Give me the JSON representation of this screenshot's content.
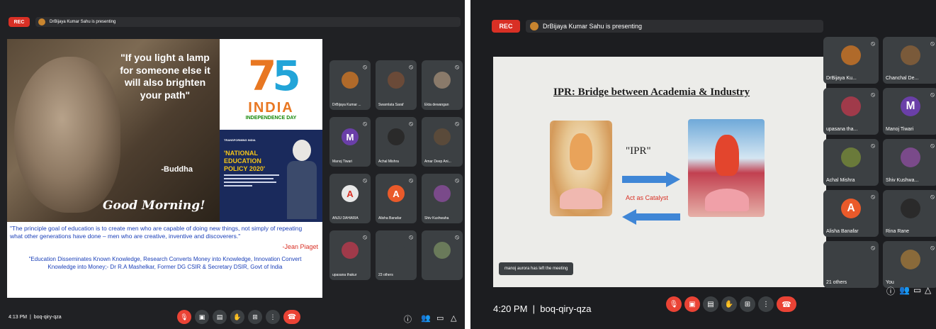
{
  "left": {
    "rec_label": "REC",
    "presenting": "DrBijaya Kumar Sahu is presenting",
    "slide": {
      "quote": "\"If you light a lamp for someone else it will also brighten your path\"",
      "quote_author": "-Buddha",
      "greeting": "Good Morning!",
      "india_logo_number": "75",
      "india_word": "INDIA",
      "india_sub": "INDEPENDENCE DAY",
      "nep_small": "TRANSFORMING INDIA",
      "nep_title": "'NATIONAL EDUCATION POLICY 2020'",
      "piaget_quote": "\"The principle goal of education is to create men who are capable of doing new things, not simply of repeating what other generations have done – men who are creative, inventive and discoverers.\"",
      "piaget_author": "-Jean Piaget",
      "mashelkar_quote": "\"Education Disseminates Known Knowledge, Research Converts Money into Knowledge, Innovation Convert Knowledge into Money;- Dr R.A Mashelkar, Former DG CSIR & Secretary DSIR, Govt of India"
    },
    "participants": [
      {
        "name": "DrBijaya Kumar ...",
        "initial": "",
        "color": "#b06a2a"
      },
      {
        "name": "Swarnlata Saraf",
        "initial": "",
        "color": "#6a4a38"
      },
      {
        "name": "Ekta dewangan",
        "initial": "",
        "color": "#8a7a6a"
      },
      {
        "name": "Manoj Tiwari",
        "initial": "M",
        "color": "#6a3fa8"
      },
      {
        "name": "Achal Mishra",
        "initial": "",
        "color": "#2a2a2a"
      },
      {
        "name": "Amar Deep Ani...",
        "initial": "",
        "color": "#5a4a3a"
      },
      {
        "name": "ANJU DAHARIA",
        "initial": "A",
        "color": "#e8e8e8"
      },
      {
        "name": "Alisha Banafar",
        "initial": "A",
        "color": "#ea5a2a"
      },
      {
        "name": "Shiv Kushwaha",
        "initial": "",
        "color": "#7a4a8a"
      },
      {
        "name": "upasana thakur",
        "initial": "",
        "color": "#a03a4a"
      },
      {
        "name": "23 others",
        "initial": "",
        "color": "#3c4043"
      },
      {
        "name": "",
        "initial": "",
        "color": "#6a7a5a"
      }
    ],
    "time": "4:13 PM",
    "meeting_code": "boq-qiry-qza"
  },
  "right": {
    "rec_label": "REC",
    "presenting": "DrBijaya Kumar Sahu is presenting",
    "slide": {
      "title": "IPR: Bridge between Academia & Industry",
      "ipr_label": "\"IPR\"",
      "catalyst": "Act as Catalyst"
    },
    "toast": "manoj aurora has left the meeting",
    "participants": [
      {
        "name": "DrBijaya Ku...",
        "initial": "",
        "color": "#b06a2a"
      },
      {
        "name": "Chanchal De...",
        "initial": "",
        "color": "#7a5a3a"
      },
      {
        "name": "upasana tha...",
        "initial": "",
        "color": "#a03a4a"
      },
      {
        "name": "Manoj Tiwari",
        "initial": "M",
        "color": "#6a3fa8"
      },
      {
        "name": "Achal Mishra",
        "initial": "",
        "color": "#6a7a3a"
      },
      {
        "name": "Shiv Kushwa...",
        "initial": "",
        "color": "#7a4a8a"
      },
      {
        "name": "Alisha Banafar",
        "initial": "A",
        "color": "#ea5a2a"
      },
      {
        "name": "Rina Rane",
        "initial": "",
        "color": "#2a2a2a"
      },
      {
        "name": "21 others",
        "initial": "",
        "color": "#3c4043"
      },
      {
        "name": "You",
        "initial": "",
        "color": "#8a6a3a"
      }
    ],
    "time": "4:20 PM",
    "meeting_code": "boq-qiry-qza"
  },
  "colors": {
    "meet_bg": "#202124",
    "tile_bg": "#3c4043",
    "red": "#ea4335",
    "blue_text": "#1a3fb8"
  },
  "icons": {
    "mic": "mic-icon",
    "camera": "camera-icon",
    "captions": "captions-icon",
    "hand": "raise-hand-icon",
    "present": "present-screen-icon",
    "more": "more-options-icon",
    "hangup": "hang-up-icon",
    "info": "info-icon",
    "people": "people-icon",
    "chat": "chat-icon",
    "activities": "activities-icon"
  }
}
